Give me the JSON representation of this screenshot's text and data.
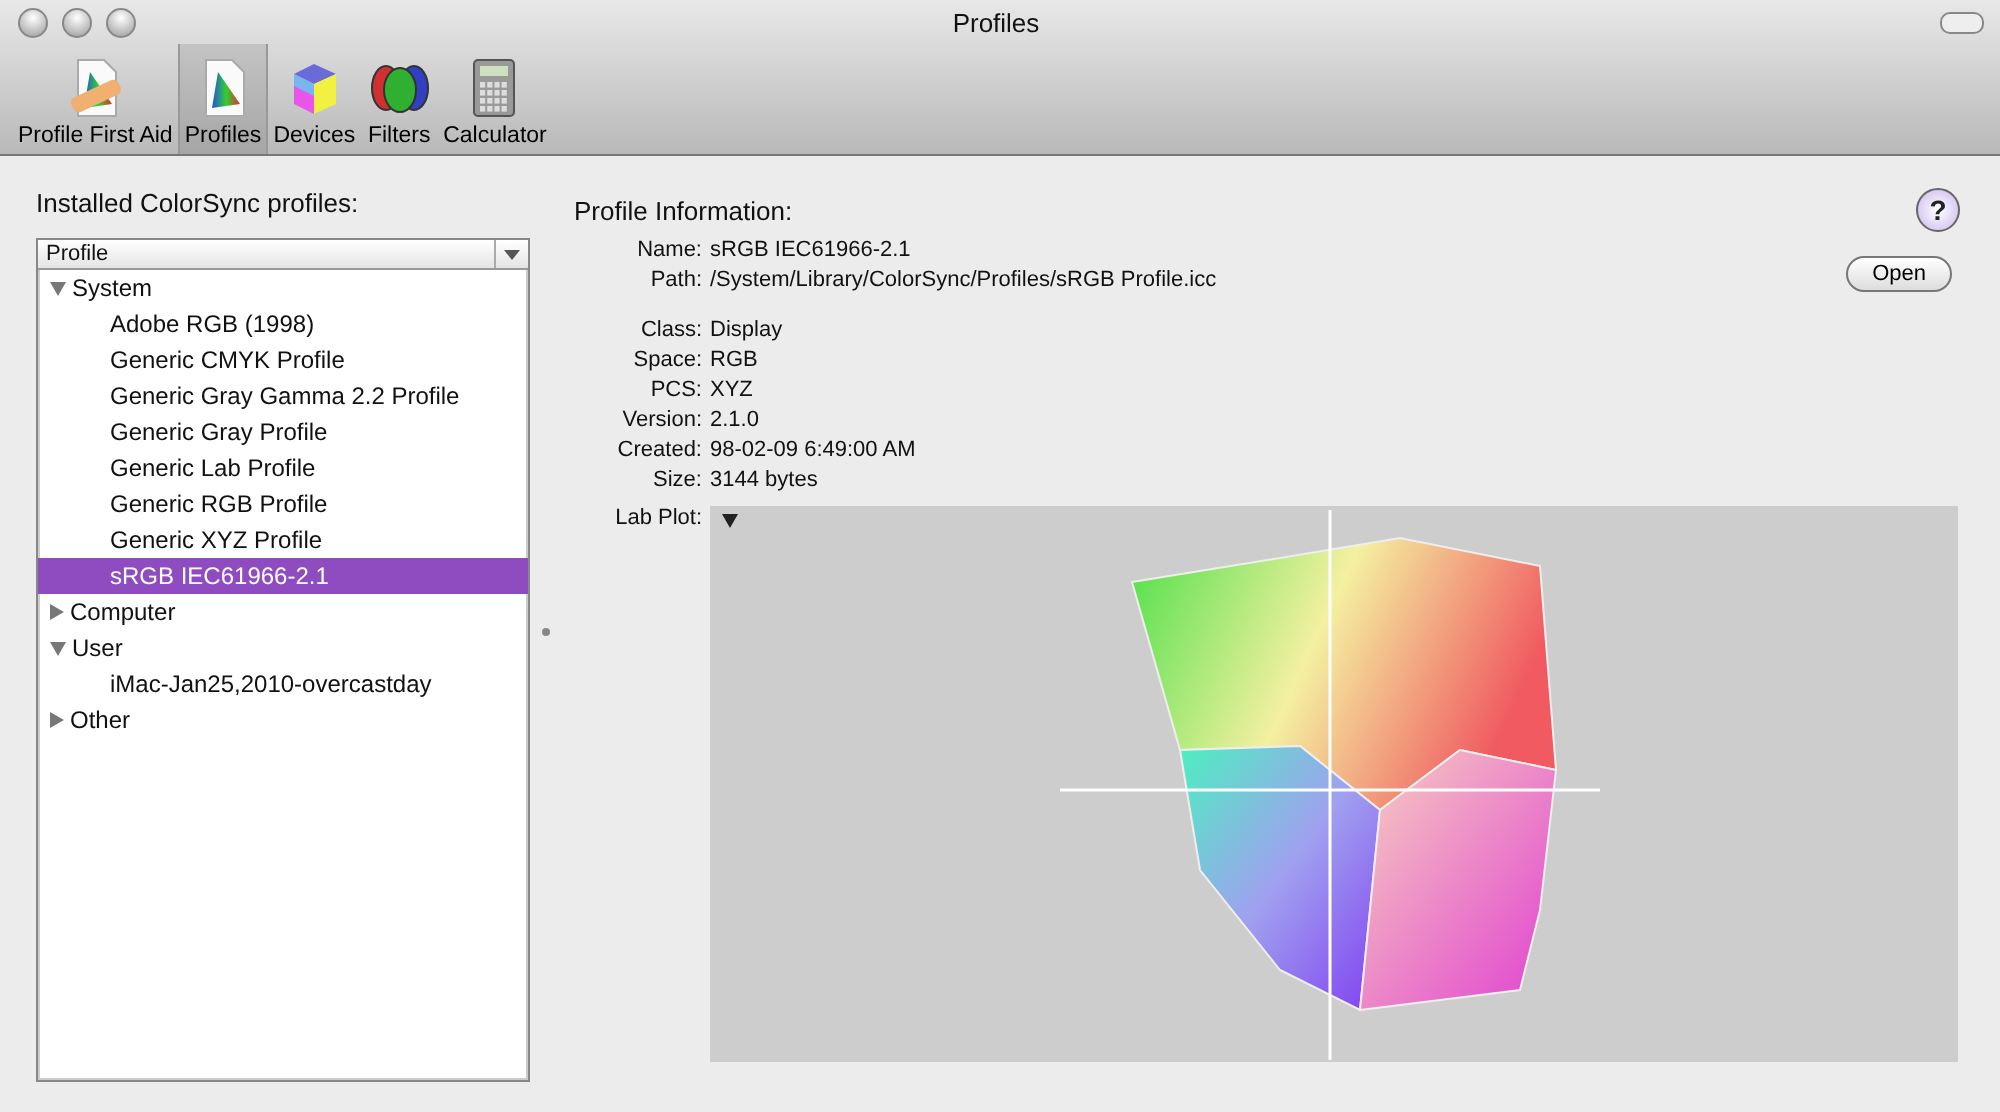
{
  "window": {
    "title": "Profiles"
  },
  "toolbar": [
    {
      "label": "Profile First Aid",
      "kind": "firstaid",
      "selected": false
    },
    {
      "label": "Profiles",
      "kind": "profiles",
      "selected": true
    },
    {
      "label": "Devices",
      "kind": "devices",
      "selected": false
    },
    {
      "label": "Filters",
      "kind": "filters",
      "selected": false
    },
    {
      "label": "Calculator",
      "kind": "calculator",
      "selected": false
    }
  ],
  "profiles_panel": {
    "heading": "Installed ColorSync profiles:",
    "column": "Profile",
    "tree": [
      {
        "label": "System",
        "expanded": true,
        "selected": false,
        "children": [
          {
            "label": "Adobe RGB (1998)",
            "selected": false
          },
          {
            "label": "Generic CMYK Profile",
            "selected": false
          },
          {
            "label": "Generic Gray Gamma 2.2 Profile",
            "selected": false
          },
          {
            "label": "Generic Gray Profile",
            "selected": false
          },
          {
            "label": "Generic Lab Profile",
            "selected": false
          },
          {
            "label": "Generic RGB Profile",
            "selected": false
          },
          {
            "label": "Generic XYZ Profile",
            "selected": false
          },
          {
            "label": "sRGB IEC61966-2.1",
            "selected": true
          }
        ]
      },
      {
        "label": "Computer",
        "expanded": false,
        "selected": false
      },
      {
        "label": "User",
        "expanded": true,
        "selected": false,
        "children": [
          {
            "label": "iMac-Jan25,2010-overcastday",
            "selected": false
          }
        ]
      },
      {
        "label": "Other",
        "expanded": false,
        "selected": false
      }
    ]
  },
  "info": {
    "heading": "Profile Information:",
    "help": "?",
    "open_button": "Open",
    "fields1": [
      {
        "label": "Name:",
        "value": "sRGB IEC61966-2.1"
      },
      {
        "label": "Path:",
        "value": "/System/Library/ColorSync/Profiles/sRGB Profile.icc"
      }
    ],
    "fields2": [
      {
        "label": "Class:",
        "value": "Display"
      },
      {
        "label": "Space:",
        "value": "RGB"
      },
      {
        "label": "PCS:",
        "value": "XYZ"
      },
      {
        "label": "Version:",
        "value": "2.1.0"
      },
      {
        "label": "Created:",
        "value": "98-02-09 6:49:00 AM"
      },
      {
        "label": "Size:",
        "value": "3144 bytes"
      }
    ],
    "plot_label": "Lab Plot:"
  }
}
